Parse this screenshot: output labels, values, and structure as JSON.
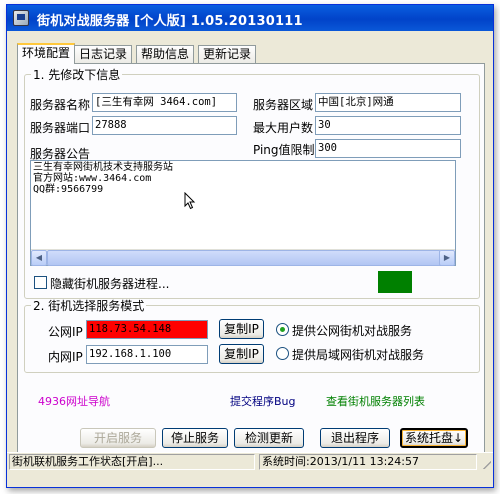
{
  "window": {
    "title": "街机对战服务器 [个人版] 1.05.20130111",
    "close_glyph": "✕"
  },
  "tabs": [
    "环境配置",
    "日志记录",
    "帮助信息",
    "更新记录"
  ],
  "section1": {
    "legend": "1. 先修改下信息",
    "server_name_label": "服务器名称",
    "server_name_value": "[三生有幸网 3464.com]",
    "server_region_label": "服务器区域",
    "server_region_value": "中国[北京]网通",
    "server_port_label": "服务器端口",
    "server_port_value": "27888",
    "max_users_label": "最大用户数",
    "max_users_value": "30",
    "ping_limit_label": "Ping值限制",
    "ping_limit_value": "300",
    "announcement_label": "服务器公告",
    "announcement_lines": [
      "三生有幸网街机技术支持服务站",
      "官方网站:www.3464.com",
      "QQ群:9566799"
    ],
    "hide_process_label": "隐藏街机服务器进程...",
    "status_color": "#008000"
  },
  "section2": {
    "legend": "2. 街机选择服务模式",
    "public_ip_label": "公网IP",
    "public_ip_value": "118.73.54.148",
    "public_ip_bg": "#ff0000",
    "private_ip_label": "内网IP",
    "private_ip_value": "192.168.1.100",
    "copy_ip_label": "复制IP",
    "mode_public_label": "提供公网街机对战服务",
    "mode_lan_label": "提供局域网街机对战服务",
    "selected_mode": "public"
  },
  "links": {
    "nav": "4936网址导航",
    "bug": "提交程序Bug",
    "list": "查看街机服务器列表",
    "nav_color": "#cc00cc",
    "bug_color": "#000080",
    "list_color": "#008000"
  },
  "buttons": {
    "start": "开启服务",
    "stop": "停止服务",
    "update": "检测更新",
    "exit": "退出程序",
    "tray": "系统托盘↓"
  },
  "statusbar": {
    "state": "街机联机服务工作状态[开启]...",
    "time": "系统时间:2013/1/11 13:24:57"
  }
}
